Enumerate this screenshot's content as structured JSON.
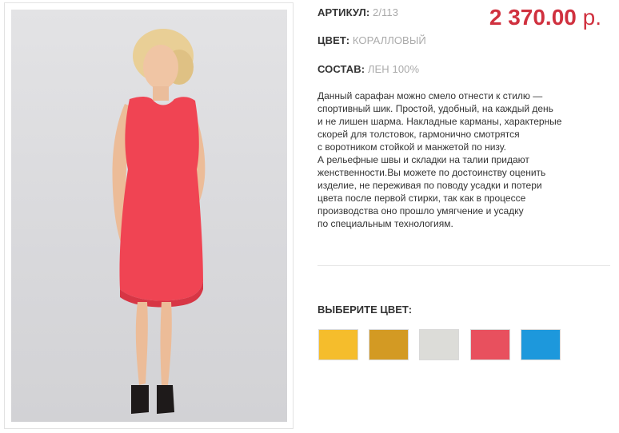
{
  "product": {
    "article_key": "АРТИКУЛ:",
    "article_value": "2/113",
    "color_key": "ЦВЕТ:",
    "color_value": "КОРАЛЛОВЫЙ",
    "composition_key": "СОСТАВ:",
    "composition_value": "ЛЕН 100%",
    "price_amount": "2 370.00",
    "price_currency": "р.",
    "price_color": "#d0313f",
    "dress_color": "#f04453",
    "description_lines": [
      "Данный сарафан можно смело отнести к стилю —",
      "спортивный шик. Простой, удобный, на каждый день",
      "и не лишен шарма. Накладные карманы, характерные",
      "скорей для толстовок, гармонично смотрятся",
      "с воротником стойкой и манжетой по низу.",
      "А рельефные швы и складки на талии придают",
      "женственности.Вы можете по достоинству оценить",
      "изделие, не переживая по поводу усадки и потери",
      "цвета после первой стирки, так как в процессе",
      "производства оно прошло умягчение и усадку",
      "по специальным технологиям."
    ]
  },
  "color_picker": {
    "title": "ВЫБЕРИТЕ ЦВЕТ:",
    "swatches": [
      {
        "name": "yellow",
        "color": "#f5bd2c"
      },
      {
        "name": "mustard",
        "color": "#d39a23"
      },
      {
        "name": "light-grey",
        "color": "#dcdcd8"
      },
      {
        "name": "coral",
        "color": "#e8505e"
      },
      {
        "name": "blue",
        "color": "#1d98dc"
      }
    ]
  }
}
